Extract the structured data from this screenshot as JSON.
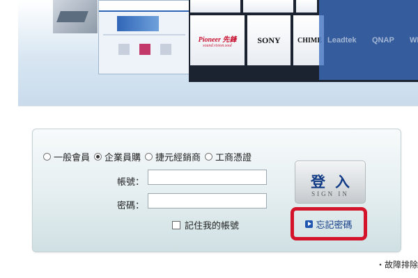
{
  "banner": {
    "brands": {
      "pioneer": "Pioneer",
      "pioneer_cn": "先鋒",
      "pioneer_tagline": "sound.vision.soul",
      "sony": "SONY",
      "chimei": "CHIME",
      "qnap": "QNAP",
      "leadtek": "Leadtek",
      "wd": "WD"
    }
  },
  "login": {
    "roles": [
      {
        "label": "一般會員",
        "checked": false
      },
      {
        "label": "企業員購",
        "checked": true
      },
      {
        "label": "捷元經銷商",
        "checked": false
      },
      {
        "label": "工商憑證",
        "checked": false
      }
    ],
    "account_label": "帳號：",
    "account_value": "",
    "password_label": "密碼：",
    "password_value": "",
    "remember_label": "記住我的帳號",
    "login_main": "登入",
    "login_sub": "SIGN IN",
    "forgot_label": "忘記密碼"
  },
  "footer": {
    "troubleshoot": "・故障排除"
  },
  "colors": {
    "highlight_border": "#d4142a",
    "button_text": "#123b86"
  }
}
